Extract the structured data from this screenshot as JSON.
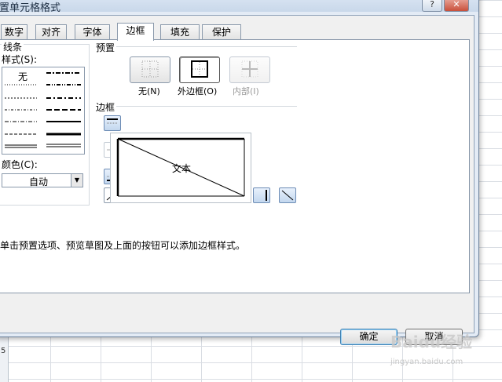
{
  "dialog": {
    "title": "置单元格格式",
    "help_icon": "?",
    "close_icon": "✕"
  },
  "tabs": [
    {
      "label": "数字"
    },
    {
      "label": "对齐"
    },
    {
      "label": "字体"
    },
    {
      "label": "边框",
      "active": true
    },
    {
      "label": "填充"
    },
    {
      "label": "保护"
    }
  ],
  "line": {
    "title": "线条",
    "style_label": "样式(S):",
    "none_label": "无",
    "color_label": "颜色(C):",
    "color_value": "自动"
  },
  "presets": {
    "title": "预置",
    "items": [
      {
        "label": "无(N)",
        "icon": "no-border-icon"
      },
      {
        "label": "外边框(O)",
        "icon": "outline-border-icon"
      },
      {
        "label": "内部(I)",
        "icon": "inside-border-icon",
        "disabled": true
      }
    ]
  },
  "border": {
    "title": "边框",
    "preview_text": "文本"
  },
  "hint": "单击预置选项、预览草图及上面的按钮可以添加边框样式。",
  "buttons": {
    "ok": "确定",
    "cancel": "取消"
  },
  "sheet": {
    "row_number": "5"
  },
  "watermark": {
    "logo": "Baidu经验",
    "url": "jingyan.baidu.com"
  }
}
